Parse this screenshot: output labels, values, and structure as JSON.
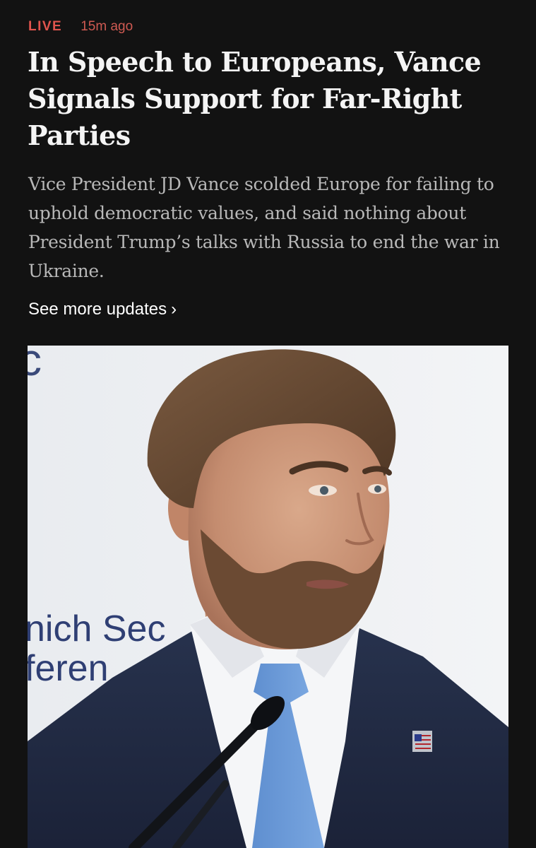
{
  "article": {
    "live_label": "LIVE",
    "timestamp": "15m ago",
    "headline": "In Speech to Europeans, Vance Signals Support for Far-Right Parties",
    "summary": "Vice President JD Vance scolded Europe for failing to uphold democratic values, and said nothing about President Trump’s talks with Russia to end the war in Ukraine.",
    "see_more_label": "See more updates",
    "see_more_icon": "chevron-right-icon"
  },
  "photo": {
    "backdrop_text_line1": "nich Sec",
    "backdrop_text_line2": "feren",
    "backdrop_text_top": "c"
  },
  "colors": {
    "background": "#121212",
    "live_accent": "#e0544d",
    "headline": "#f4f4f4",
    "summary": "#b8b8b8",
    "link": "#ffffff"
  }
}
